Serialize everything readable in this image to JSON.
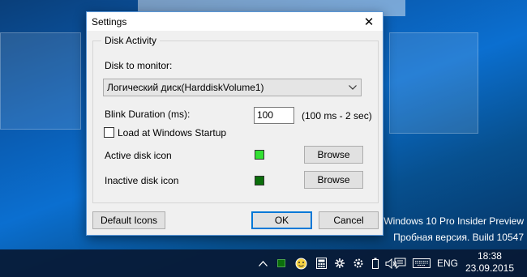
{
  "dialog": {
    "title": "Settings",
    "close_glyph": "✕",
    "group_title": "Disk Activity",
    "disk_label": "Disk to monitor:",
    "disk_selected": "Логический диск(HarddiskVolume1)",
    "blink_label": "Blink Duration (ms):",
    "blink_value": "100",
    "blink_hint": "(100 ms - 2 sec)",
    "startup_label": "Load at Windows Startup",
    "startup_checked": false,
    "active_label": "Active disk icon",
    "inactive_label": "Inactive disk icon",
    "browse_label": "Browse",
    "default_icons_label": "Default Icons",
    "ok_label": "OK",
    "cancel_label": "Cancel"
  },
  "colors": {
    "active_icon": "#33e033",
    "inactive_icon": "#0b6e0b",
    "title_bar": "#ffffff",
    "dialog_border": "#5b97d7",
    "default_button_border": "#0078d7"
  },
  "watermark": {
    "line1": "Windows 10 Pro Insider Preview",
    "line2": "Пробная версия. Build 10547"
  },
  "taskbar": {
    "tray_icons": [
      "chevron-up-icon",
      "disk-activity-icon",
      "emoji-icon",
      "calculator-icon",
      "network-icon",
      "settings-icon",
      "power-icon",
      "volume-icon",
      "notifications-icon",
      "keyboard-icon"
    ],
    "language": "ENG",
    "time": "18:38",
    "date": "23.09.2015"
  }
}
